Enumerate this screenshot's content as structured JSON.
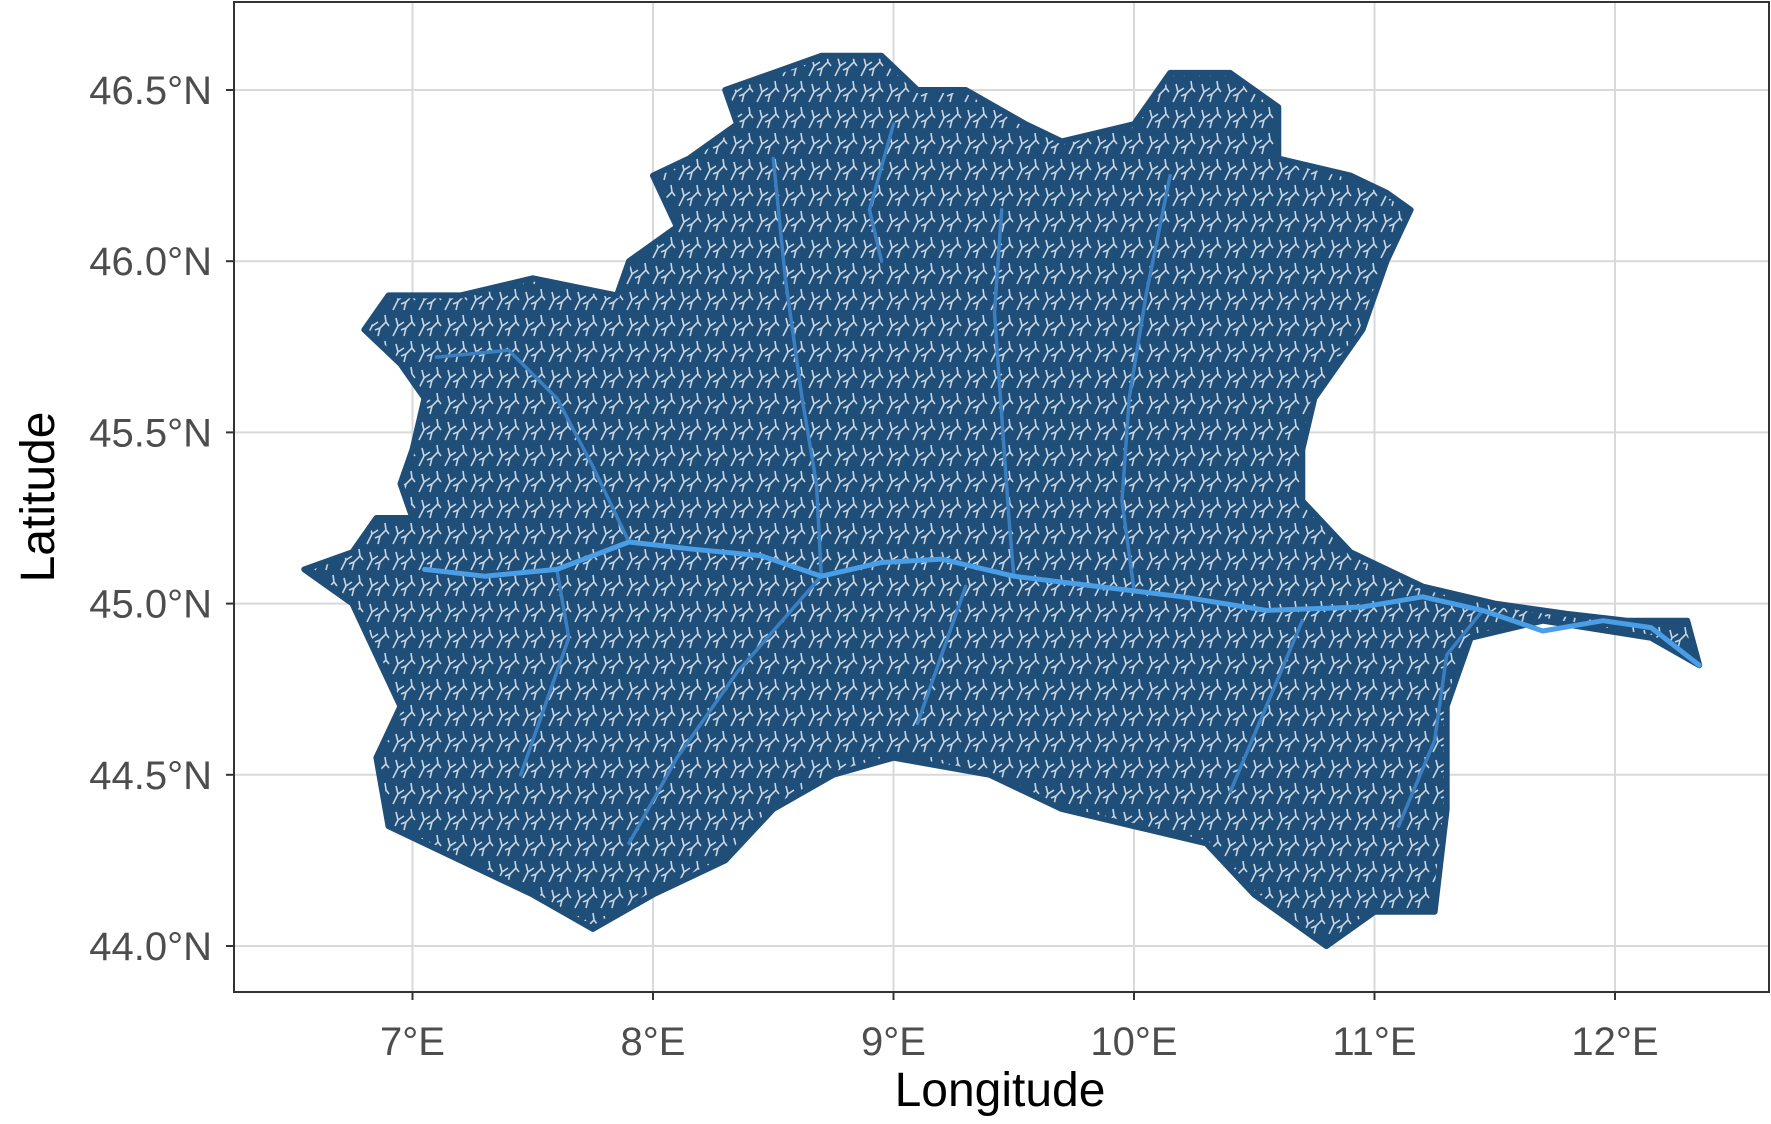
{
  "chart_data": {
    "type": "map",
    "subject": "river network",
    "xlabel": "Longitude",
    "ylabel": "Latitude",
    "xlim": [
      6.3,
      12.65
    ],
    "ylim": [
      43.88,
      46.75
    ],
    "x_ticks": [
      {
        "value": 7,
        "label": "7°E"
      },
      {
        "value": 8,
        "label": "8°E"
      },
      {
        "value": 9,
        "label": "9°E"
      },
      {
        "value": 10,
        "label": "10°E"
      },
      {
        "value": 11,
        "label": "11°E"
      },
      {
        "value": 12,
        "label": "12°E"
      }
    ],
    "y_ticks": [
      {
        "value": 44.0,
        "label": "44.0°N"
      },
      {
        "value": 44.5,
        "label": "44.5°N"
      },
      {
        "value": 45.0,
        "label": "45.0°N"
      },
      {
        "value": 45.5,
        "label": "45.5°N"
      },
      {
        "value": 46.0,
        "label": "46.0°N"
      },
      {
        "value": 46.5,
        "label": "46.5°N"
      }
    ],
    "grid": true,
    "colors": {
      "basin_fill": "#1f4e79",
      "minor_streams": "#e8eef4",
      "main_river": "#4a9ee6",
      "tributaries": "#3b7fc0",
      "grid": "#d9d9d9",
      "panel_border": "#333333"
    },
    "basin_outline": [
      [
        6.55,
        45.1
      ],
      [
        6.75,
        45.15
      ],
      [
        6.85,
        45.25
      ],
      [
        7.0,
        45.25
      ],
      [
        6.95,
        45.35
      ],
      [
        7.0,
        45.45
      ],
      [
        7.05,
        45.6
      ],
      [
        6.95,
        45.7
      ],
      [
        6.8,
        45.8
      ],
      [
        6.9,
        45.9
      ],
      [
        7.2,
        45.9
      ],
      [
        7.5,
        45.95
      ],
      [
        7.85,
        45.9
      ],
      [
        7.9,
        46.0
      ],
      [
        8.1,
        46.1
      ],
      [
        8.0,
        46.25
      ],
      [
        8.15,
        46.3
      ],
      [
        8.35,
        46.4
      ],
      [
        8.3,
        46.5
      ],
      [
        8.5,
        46.55
      ],
      [
        8.7,
        46.6
      ],
      [
        8.95,
        46.6
      ],
      [
        9.1,
        46.5
      ],
      [
        9.3,
        46.5
      ],
      [
        9.55,
        46.4
      ],
      [
        9.7,
        46.35
      ],
      [
        10.0,
        46.4
      ],
      [
        10.15,
        46.55
      ],
      [
        10.4,
        46.55
      ],
      [
        10.6,
        46.45
      ],
      [
        10.6,
        46.3
      ],
      [
        10.9,
        46.25
      ],
      [
        11.05,
        46.2
      ],
      [
        11.15,
        46.15
      ],
      [
        11.05,
        46.0
      ],
      [
        10.95,
        45.8
      ],
      [
        10.75,
        45.6
      ],
      [
        10.7,
        45.45
      ],
      [
        10.7,
        45.3
      ],
      [
        10.9,
        45.15
      ],
      [
        11.2,
        45.05
      ],
      [
        11.5,
        45.0
      ],
      [
        11.8,
        44.97
      ],
      [
        12.05,
        44.95
      ],
      [
        12.3,
        44.95
      ],
      [
        12.35,
        44.82
      ],
      [
        12.15,
        44.9
      ],
      [
        11.7,
        44.95
      ],
      [
        11.4,
        44.9
      ],
      [
        11.3,
        44.7
      ],
      [
        11.3,
        44.4
      ],
      [
        11.25,
        44.1
      ],
      [
        11.0,
        44.1
      ],
      [
        10.8,
        44.0
      ],
      [
        10.5,
        44.15
      ],
      [
        10.3,
        44.3
      ],
      [
        10.0,
        44.35
      ],
      [
        9.7,
        44.4
      ],
      [
        9.4,
        44.5
      ],
      [
        9.0,
        44.55
      ],
      [
        8.75,
        44.5
      ],
      [
        8.5,
        44.4
      ],
      [
        8.3,
        44.25
      ],
      [
        8.0,
        44.15
      ],
      [
        7.75,
        44.05
      ],
      [
        7.5,
        44.15
      ],
      [
        7.2,
        44.25
      ],
      [
        6.9,
        44.35
      ],
      [
        6.85,
        44.55
      ],
      [
        6.95,
        44.7
      ],
      [
        6.85,
        44.85
      ],
      [
        6.75,
        45.0
      ],
      [
        6.55,
        45.1
      ]
    ],
    "main_river": [
      [
        7.05,
        45.1
      ],
      [
        7.3,
        45.08
      ],
      [
        7.6,
        45.1
      ],
      [
        7.9,
        45.18
      ],
      [
        8.15,
        45.16
      ],
      [
        8.45,
        45.14
      ],
      [
        8.7,
        45.08
      ],
      [
        8.95,
        45.12
      ],
      [
        9.2,
        45.13
      ],
      [
        9.5,
        45.08
      ],
      [
        9.85,
        45.05
      ],
      [
        10.2,
        45.02
      ],
      [
        10.55,
        44.98
      ],
      [
        10.95,
        44.99
      ],
      [
        11.2,
        45.02
      ],
      [
        11.45,
        44.98
      ],
      [
        11.7,
        44.92
      ],
      [
        11.95,
        44.95
      ],
      [
        12.15,
        44.93
      ],
      [
        12.35,
        44.82
      ]
    ],
    "tributaries": [
      [
        [
          7.1,
          45.72
        ],
        [
          7.4,
          45.74
        ],
        [
          7.6,
          45.6
        ],
        [
          7.75,
          45.4
        ],
        [
          7.9,
          45.18
        ]
      ],
      [
        [
          8.5,
          46.3
        ],
        [
          8.55,
          45.95
        ],
        [
          8.62,
          45.6
        ],
        [
          8.68,
          45.35
        ],
        [
          8.7,
          45.08
        ]
      ],
      [
        [
          9.45,
          46.15
        ],
        [
          9.42,
          45.85
        ],
        [
          9.45,
          45.55
        ],
        [
          9.48,
          45.25
        ],
        [
          9.5,
          45.08
        ]
      ],
      [
        [
          10.15,
          46.25
        ],
        [
          10.05,
          45.9
        ],
        [
          9.98,
          45.6
        ],
        [
          9.95,
          45.3
        ],
        [
          10.0,
          45.04
        ]
      ],
      [
        [
          7.45,
          44.5
        ],
        [
          7.55,
          44.7
        ],
        [
          7.65,
          44.9
        ],
        [
          7.6,
          45.1
        ]
      ],
      [
        [
          7.9,
          44.3
        ],
        [
          8.1,
          44.55
        ],
        [
          8.35,
          44.8
        ],
        [
          8.7,
          45.08
        ]
      ],
      [
        [
          9.1,
          44.65
        ],
        [
          9.2,
          44.85
        ],
        [
          9.3,
          45.05
        ]
      ],
      [
        [
          10.4,
          44.45
        ],
        [
          10.55,
          44.7
        ],
        [
          10.7,
          44.95
        ]
      ],
      [
        [
          11.1,
          44.35
        ],
        [
          11.25,
          44.6
        ],
        [
          11.3,
          44.85
        ],
        [
          11.45,
          44.98
        ]
      ],
      [
        [
          9.0,
          46.4
        ],
        [
          8.9,
          46.15
        ],
        [
          8.95,
          46.0
        ]
      ]
    ]
  }
}
